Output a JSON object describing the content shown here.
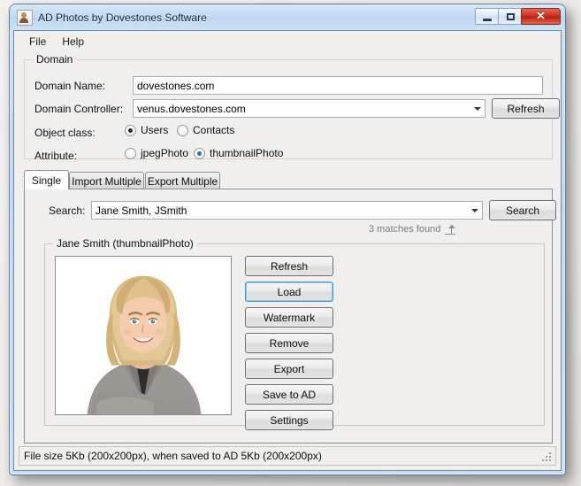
{
  "window": {
    "title": "AD Photos by Dovestones Software",
    "icon": "photo-person-icon",
    "minimize_label": "–",
    "maximize_label": "□",
    "close_label": "✕"
  },
  "menu": {
    "items": [
      {
        "label": "File"
      },
      {
        "label": "Help"
      }
    ]
  },
  "domain_group": {
    "legend": "Domain",
    "domain_name_label": "Domain Name:",
    "domain_name_value": "dovestones.com",
    "domain_controller_label": "Domain Controller:",
    "domain_controller_value": "venus.dovestones.com",
    "refresh_button": "Refresh",
    "object_class_label": "Object class:",
    "object_class_options": [
      {
        "label": "Users",
        "checked": true
      },
      {
        "label": "Contacts",
        "checked": false
      }
    ],
    "attribute_label": "Attribute:",
    "attribute_options": [
      {
        "label": "jpegPhoto",
        "checked": false
      },
      {
        "label": "thumbnailPhoto",
        "checked": true
      }
    ]
  },
  "tabs": [
    {
      "label": "Single",
      "active": true
    },
    {
      "label": "Import Multiple",
      "active": false
    },
    {
      "label": "Export Multiple",
      "active": false
    }
  ],
  "single_tab": {
    "search_label": "Search:",
    "search_value": "Jane Smith, JSmith",
    "search_button": "Search",
    "matches_text": "3 matches found",
    "matches_icon": "expand-grip-icon",
    "photo_group_legend": "Jane Smith (thumbnailPhoto)",
    "photo_alt": "portrait-photo",
    "buttons": [
      {
        "label": "Refresh",
        "focused": false
      },
      {
        "label": "Load",
        "focused": true
      },
      {
        "label": "Watermark",
        "focused": false
      },
      {
        "label": "Remove",
        "focused": false
      },
      {
        "label": "Export",
        "focused": false
      },
      {
        "label": "Save to AD",
        "focused": false
      },
      {
        "label": "Settings",
        "focused": false
      }
    ]
  },
  "statusbar": {
    "text": "File size 5Kb (200x200px), when saved to AD 5Kb (200x200px)",
    "grip_icon": "resize-grip-icon"
  },
  "colors": {
    "titlebar_start": "#d8e8f7",
    "titlebar_end": "#cbe2f7",
    "frame_border": "#5c7f9e",
    "focus_blue": "#3c9cd4",
    "close_red": "#cf3022",
    "radio_blue": "#1878c8",
    "window_bg": "#f0efed"
  }
}
